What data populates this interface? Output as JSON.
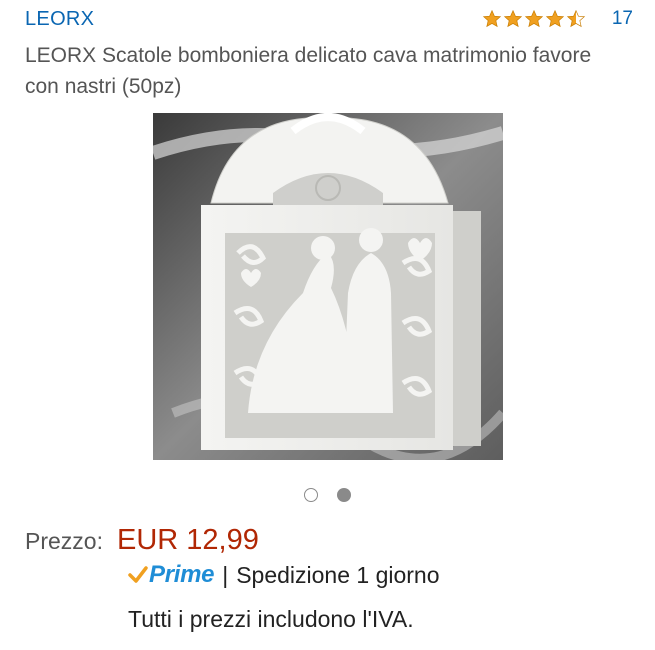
{
  "header": {
    "brand": "LEORX",
    "rating": {
      "stars": 4.5,
      "count": "17"
    }
  },
  "product": {
    "title": "LEORX Scatole bomboniera delicato cava matrimonio favore con nastri (50pz)",
    "image": {
      "icon": "wedding-favor-box-photo"
    },
    "carousel": {
      "total": 2,
      "current": 2
    }
  },
  "pricing": {
    "label": "Prezzo:",
    "value": "EUR 12,99"
  },
  "shipping": {
    "prime_label": "Prime",
    "separator": "|",
    "text": "Spedizione 1 giorno",
    "prime_color": "#1f8dd6",
    "check_color": "#f0a020"
  },
  "vat_note": "Tutti i prezzi includono l'IVA.",
  "colors": {
    "link": "#0a66b2",
    "price": "#b12704",
    "star": "#f0a020"
  }
}
